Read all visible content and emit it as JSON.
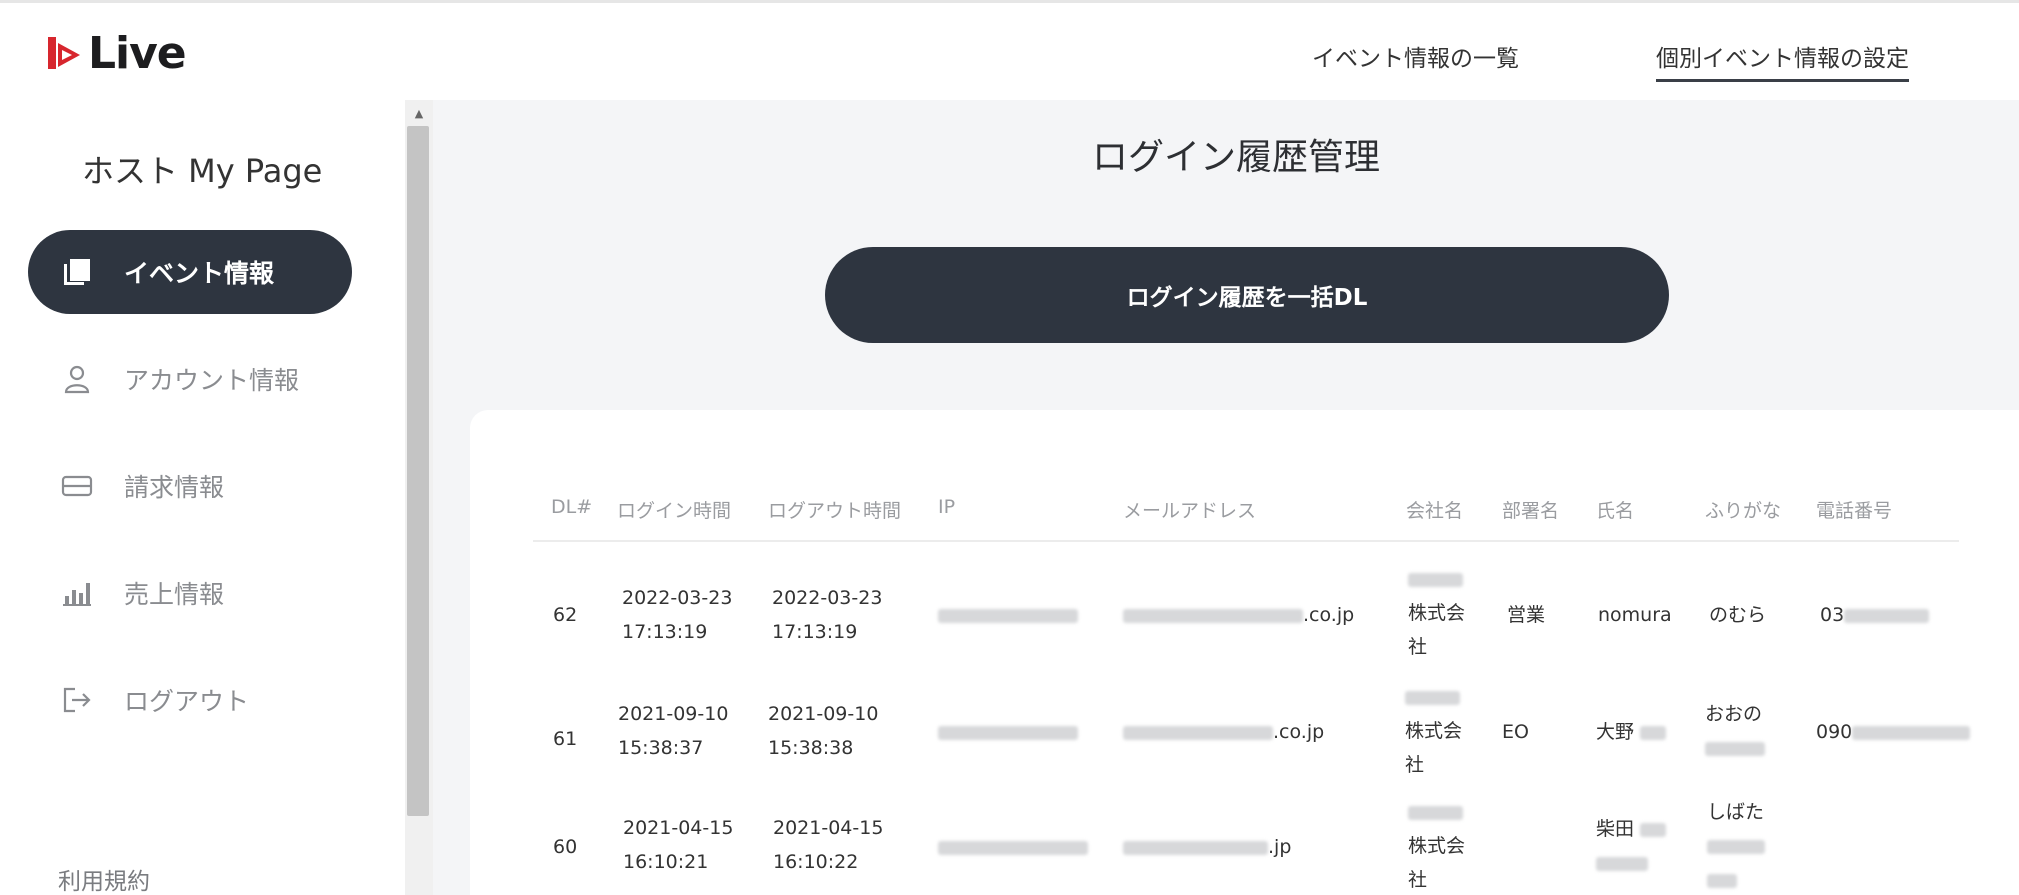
{
  "header": {
    "logo_text": "Live",
    "nav": [
      "イベント情報の一覧",
      "個別イベント情報の設定"
    ]
  },
  "sidebar": {
    "title": "ホスト My Page",
    "items": [
      {
        "label": "イベント情報",
        "icon": "book-icon",
        "active": true
      },
      {
        "label": "アカウント情報",
        "icon": "user-icon",
        "active": false
      },
      {
        "label": "請求情報",
        "icon": "credit-card-icon",
        "active": false
      },
      {
        "label": "売上情報",
        "icon": "bar-chart-icon",
        "active": false
      },
      {
        "label": "ログアウト",
        "icon": "logout-icon",
        "active": false
      }
    ],
    "terms_link": "利用規約"
  },
  "main": {
    "title": "ログイン履歴管理",
    "download_button": "ログイン履歴を一括DL",
    "table": {
      "columns": [
        "DL#",
        "ログイン時間",
        "ログアウト時間",
        "IP",
        "メールアドレス",
        "会社名",
        "部署名",
        "氏名",
        "ふりがな",
        "電話番号"
      ],
      "rows": [
        {
          "dl": "62",
          "login_date": "2022-03-23",
          "login_time": "17:13:19",
          "logout_date": "2022-03-23",
          "logout_time": "17:13:19",
          "email_suffix": ".co.jp",
          "company_line1": "株式会",
          "company_line2": "社",
          "dept": "営業",
          "name": "nomura",
          "kana": "のむら",
          "phone_prefix": "03"
        },
        {
          "dl": "61",
          "login_date": "2021-09-10",
          "login_time": "15:38:37",
          "logout_date": "2021-09-10",
          "logout_time": "15:38:38",
          "email_suffix": ".co.jp",
          "company_line1": "株式会",
          "company_line2": "社",
          "dept": "EO",
          "name": "大野",
          "kana": "おおの",
          "phone_prefix": "090"
        },
        {
          "dl": "60",
          "login_date": "2021-04-15",
          "login_time": "16:10:21",
          "logout_date": "2021-04-15",
          "logout_time": "16:10:22",
          "email_suffix": ".jp",
          "company_line1": "株式会",
          "company_line2": "社",
          "dept": "",
          "name": "柴田",
          "kana": "しばた",
          "phone_prefix": ""
        }
      ]
    }
  }
}
